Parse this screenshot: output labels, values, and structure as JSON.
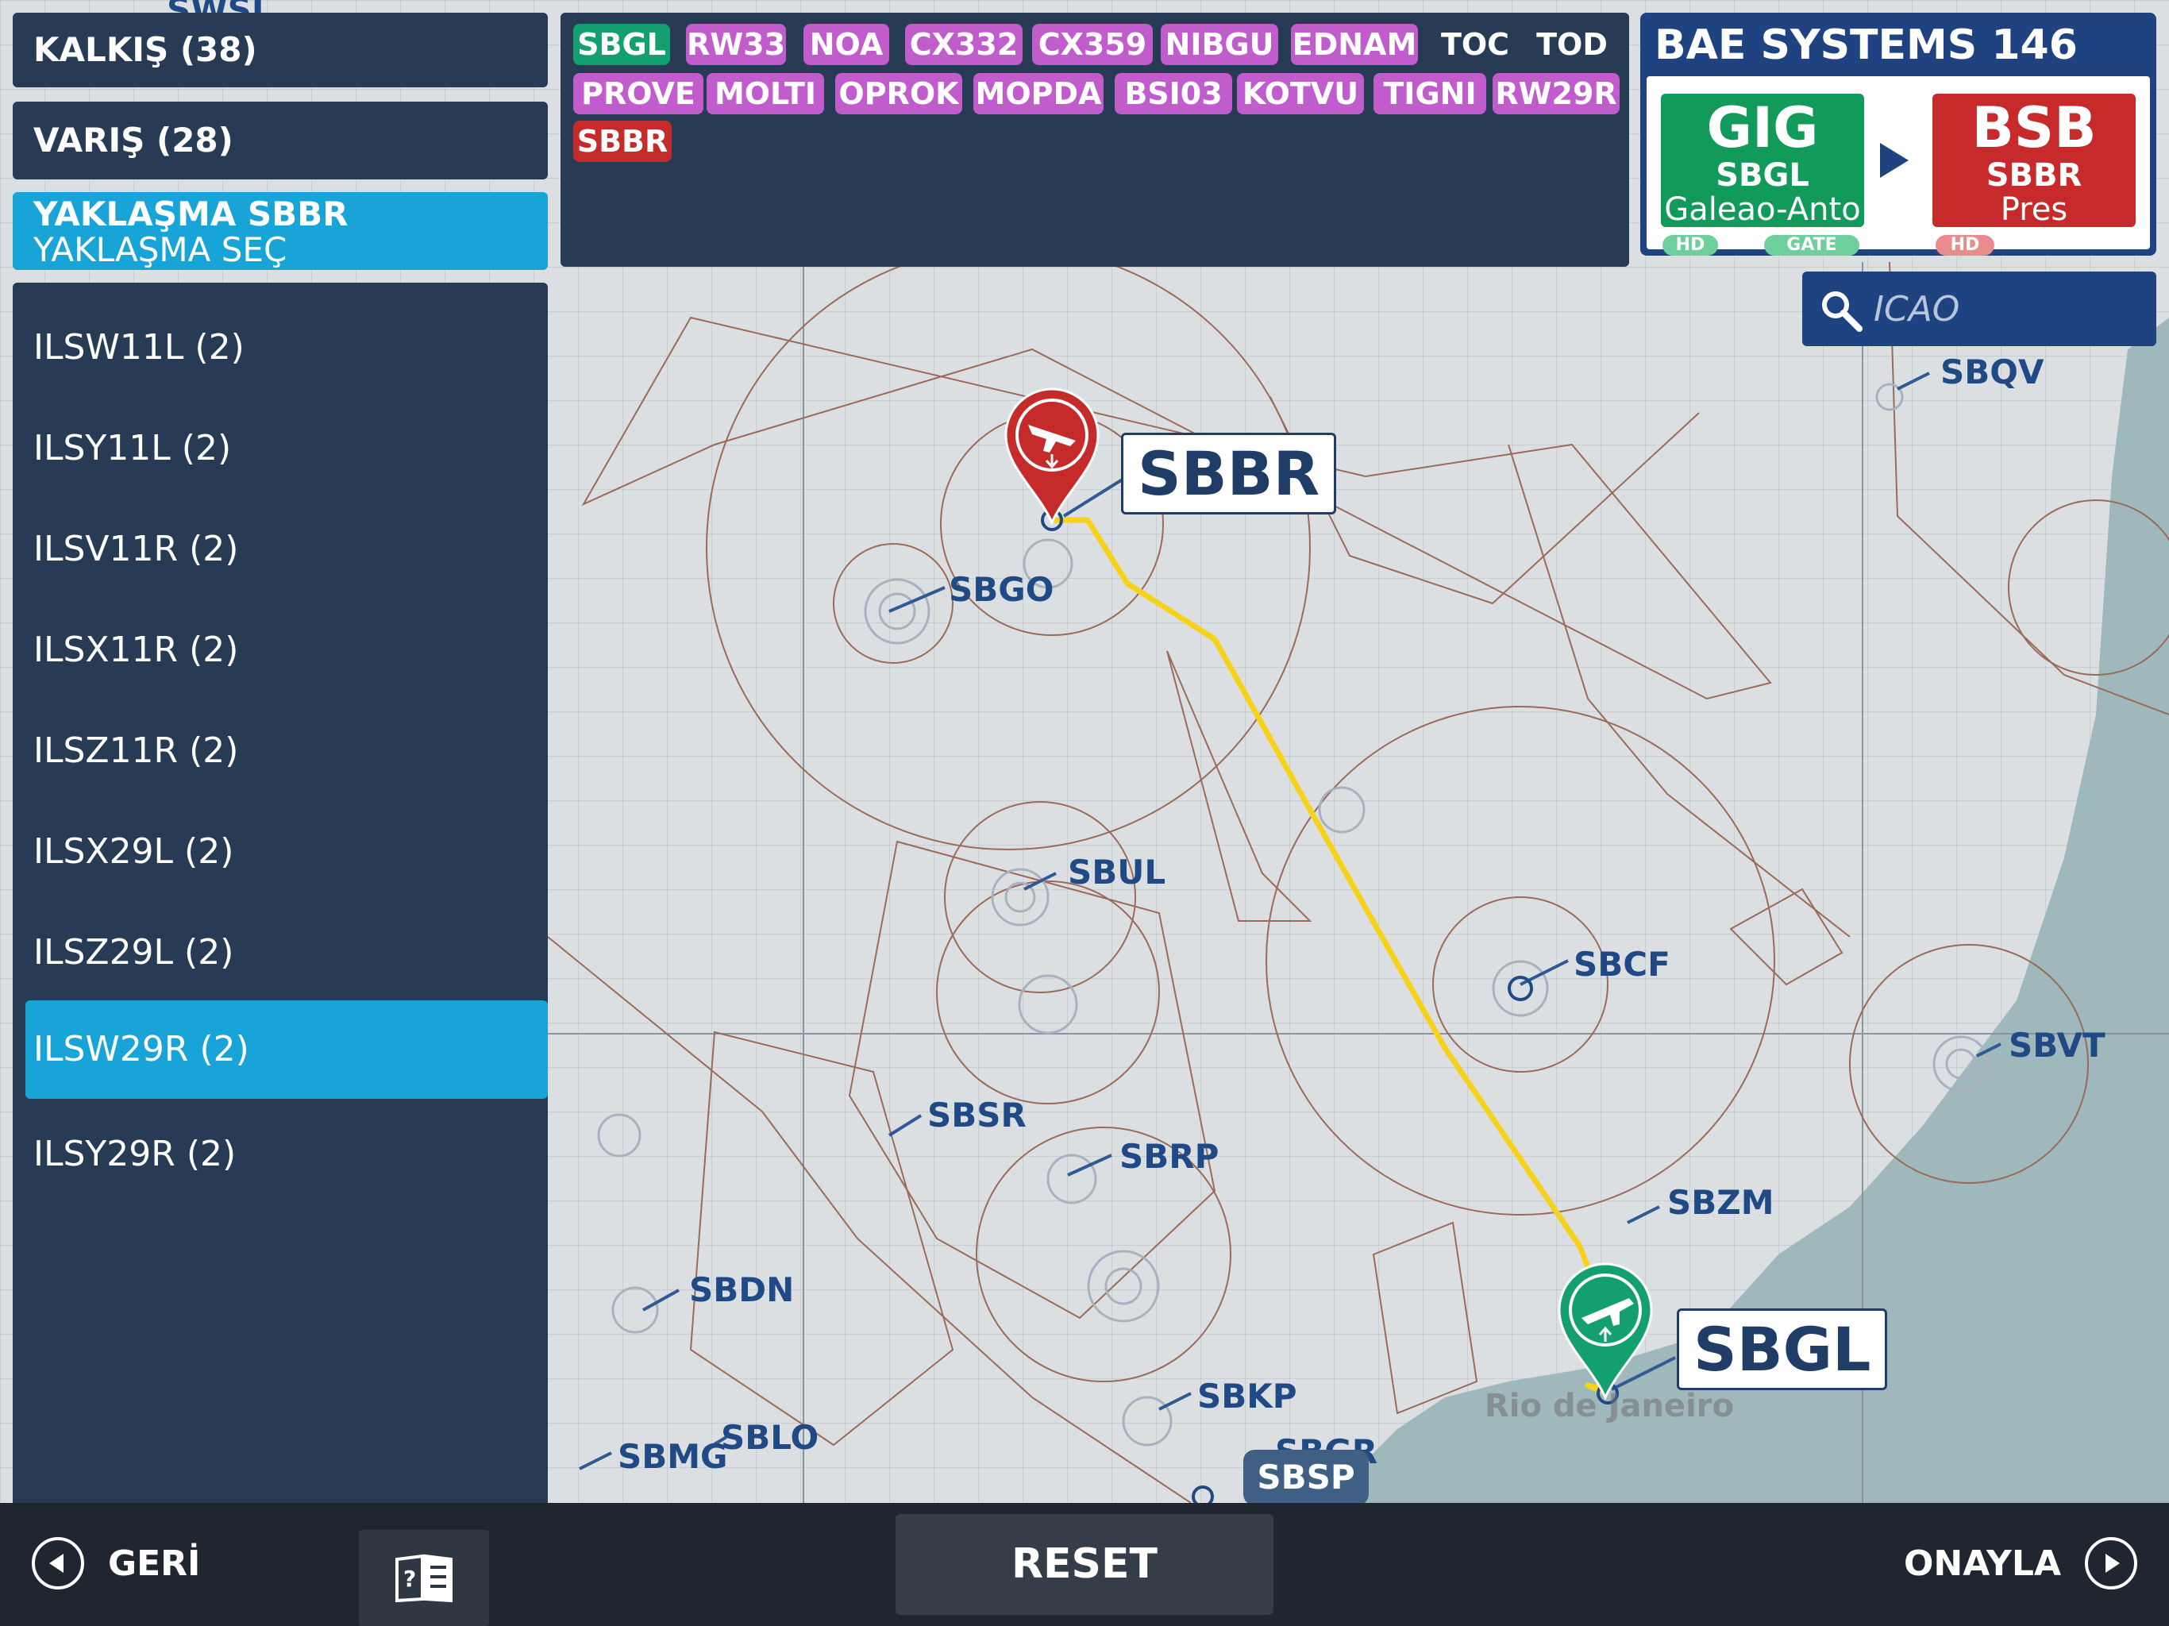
{
  "left_panel": {
    "departure_label": "KALKIŞ (38)",
    "arrival_label": "VARIŞ (28)",
    "approach_title": "YAKLAŞMA SBBR",
    "approach_subtitle": "YAKLAŞMA SEÇ",
    "approaches": [
      {
        "label": "ILSW11L (2)",
        "selected": false
      },
      {
        "label": "ILSY11L (2)",
        "selected": false
      },
      {
        "label": "ILSV11R (2)",
        "selected": false
      },
      {
        "label": "ILSX11R (2)",
        "selected": false
      },
      {
        "label": "ILSZ11R (2)",
        "selected": false
      },
      {
        "label": "ILSX29L (2)",
        "selected": false
      },
      {
        "label": "ILSZ29L (2)",
        "selected": false
      },
      {
        "label": "ILSW29R (2)",
        "selected": true
      },
      {
        "label": "ILSY29R (2)",
        "selected": false
      }
    ]
  },
  "route": {
    "waypoints": [
      {
        "label": "SBGL",
        "kind": "origin"
      },
      {
        "label": "RW33",
        "kind": "fix"
      },
      {
        "label": "NOA",
        "kind": "fix"
      },
      {
        "label": "CX332",
        "kind": "fix"
      },
      {
        "label": "CX359",
        "kind": "fix"
      },
      {
        "label": "NIBGU",
        "kind": "fix"
      },
      {
        "label": "EDNAM",
        "kind": "fix"
      },
      {
        "label": "TOC",
        "kind": "marker"
      },
      {
        "label": "TOD",
        "kind": "marker"
      },
      {
        "label": "PROVE",
        "kind": "fix"
      },
      {
        "label": "MOLTI",
        "kind": "fix"
      },
      {
        "label": "OPROK",
        "kind": "fix"
      },
      {
        "label": "MOPDA",
        "kind": "fix"
      },
      {
        "label": "BSI03",
        "kind": "fix"
      },
      {
        "label": "KOTVU",
        "kind": "fix"
      },
      {
        "label": "TIGNI",
        "kind": "fix"
      },
      {
        "label": "RW29R",
        "kind": "fix"
      },
      {
        "label": "SBBR",
        "kind": "destination"
      }
    ]
  },
  "aircraft": {
    "name": "BAE SYSTEMS 146",
    "origin": {
      "iata": "GIG",
      "icao": "SBGL",
      "name": "Galeao-Anto",
      "tags": [
        "HD",
        "GATE"
      ]
    },
    "destination": {
      "iata": "BSB",
      "icao": "SBBR",
      "name": "Pres",
      "tags": [
        "HD"
      ]
    }
  },
  "search": {
    "placeholder": "ICAO"
  },
  "map": {
    "origin_pin_label": "SBGL",
    "destination_pin_label": "SBBR",
    "city_label": "Rio de Janeiro",
    "top_partial_label": "SWSI",
    "airports": [
      "SBGO",
      "SBUL",
      "SBCF",
      "SBVT",
      "SBSR",
      "SBRP",
      "SBZM",
      "SBDN",
      "SBKP",
      "SBMG",
      "SBLO",
      "SBGR",
      "SBQV"
    ],
    "highlighted_airport": "SBSP",
    "route_color": "#f7d21b",
    "origin_color": "#14a06e",
    "destination_color": "#c52b2b"
  },
  "bottom_bar": {
    "back_label": "GERİ",
    "reset_label": "RESET",
    "confirm_label": "ONAYLA"
  }
}
